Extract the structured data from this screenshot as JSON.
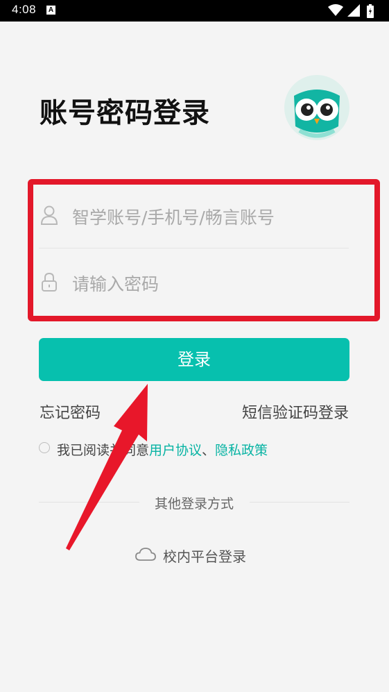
{
  "status_bar": {
    "time": "4:08",
    "notif_icon": "A"
  },
  "page": {
    "title": "账号密码登录"
  },
  "form": {
    "username_placeholder": "智学账号/手机号/畅言账号",
    "password_placeholder": "请输入密码",
    "login_label": "登录"
  },
  "links": {
    "forgot": "忘记密码",
    "sms_login": "短信验证码登录"
  },
  "agreement": {
    "prefix": "我已阅读并同意",
    "user_agreement": "用户协议",
    "separator": "、",
    "privacy_policy": "隐私政策"
  },
  "other": {
    "label": "其他登录方式",
    "campus_login": "校内平台登录"
  },
  "colors": {
    "accent": "#07c0ae",
    "highlight": "#e3182a",
    "link": "#07b3a3"
  }
}
